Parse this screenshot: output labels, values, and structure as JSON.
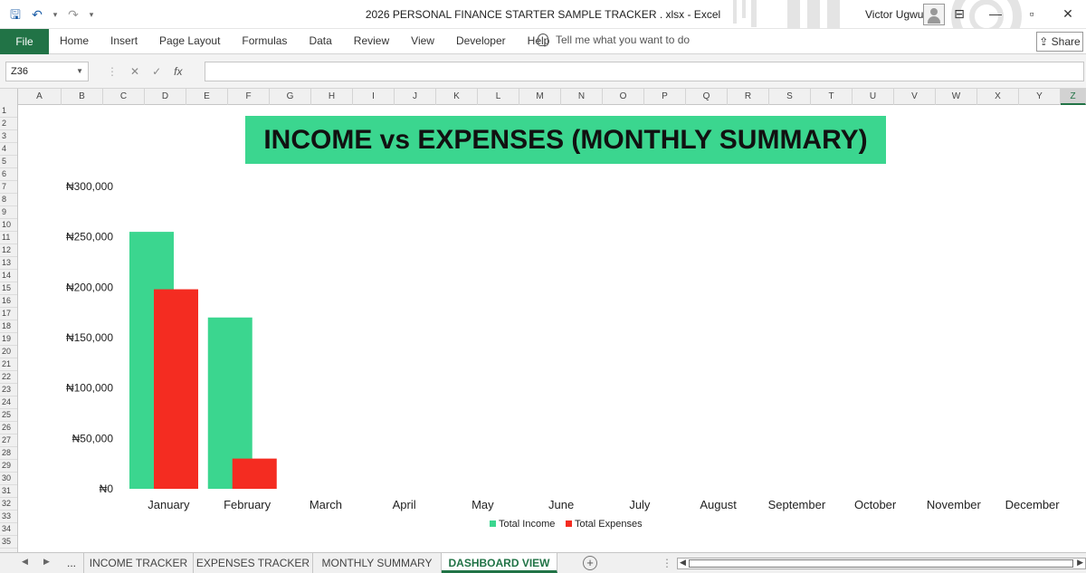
{
  "window": {
    "title": "2026 PERSONAL FINANCE STARTER SAMPLE TRACKER . xlsx  -  Excel",
    "user": "Victor Ugwu",
    "controls": {
      "restore": "▫",
      "close": "✕"
    }
  },
  "quick_access": {
    "save": "🖫",
    "undo": "↶",
    "redo": "↷",
    "customize": "▾"
  },
  "ribbon": {
    "file": "File",
    "tabs": [
      "Home",
      "Insert",
      "Page Layout",
      "Formulas",
      "Data",
      "Review",
      "View",
      "Developer",
      "Help"
    ],
    "tell_me": "Tell me what you want to do",
    "share": "Share"
  },
  "formula_bar": {
    "name_box": "Z36",
    "cancel": "✕",
    "enter": "✓",
    "fx": "fx",
    "value": ""
  },
  "grid": {
    "columns": [
      "A",
      "B",
      "C",
      "D",
      "E",
      "F",
      "G",
      "H",
      "I",
      "J",
      "K",
      "L",
      "M",
      "N",
      "O",
      "P",
      "Q",
      "R",
      "S",
      "T",
      "U",
      "V",
      "W",
      "X",
      "Y",
      "Z"
    ],
    "selected_column": "Z",
    "rows": [
      "1",
      "2",
      "3",
      "4",
      "5",
      "6",
      "7",
      "8",
      "9",
      "10",
      "11",
      "12",
      "13",
      "14",
      "15",
      "16",
      "17",
      "18",
      "19",
      "20",
      "21",
      "22",
      "23",
      "24",
      "25",
      "26",
      "27",
      "28",
      "29",
      "30",
      "31",
      "32",
      "33",
      "34",
      "35"
    ]
  },
  "sheet_tabs": {
    "more": "...",
    "tabs": [
      "INCOME TRACKER",
      "EXPENSES TRACKER",
      "MONTHLY SUMMARY",
      "DASHBOARD VIEW"
    ],
    "active": "DASHBOARD VIEW",
    "add": "+"
  },
  "chart_data": {
    "type": "bar",
    "title": "INCOME vs EXPENSES (MONTHLY SUMMARY)",
    "categories": [
      "January",
      "February",
      "March",
      "April",
      "May",
      "June",
      "July",
      "August",
      "September",
      "October",
      "November",
      "December"
    ],
    "series": [
      {
        "name": "Total Income",
        "color": "#3bd68f",
        "values": [
          255000,
          170000,
          0,
          0,
          0,
          0,
          0,
          0,
          0,
          0,
          0,
          0
        ]
      },
      {
        "name": "Total Expenses",
        "color": "#f42c21",
        "values": [
          198000,
          30000,
          0,
          0,
          0,
          0,
          0,
          0,
          0,
          0,
          0,
          0
        ]
      }
    ],
    "y_ticks": [
      "₦0",
      "₦50,000",
      "₦100,000",
      "₦150,000",
      "₦200,000",
      "₦250,000",
      "₦300,000"
    ],
    "ylim": [
      0,
      300000
    ],
    "grid": false,
    "legend_position": "bottom",
    "title_background": "#3bd68f"
  }
}
